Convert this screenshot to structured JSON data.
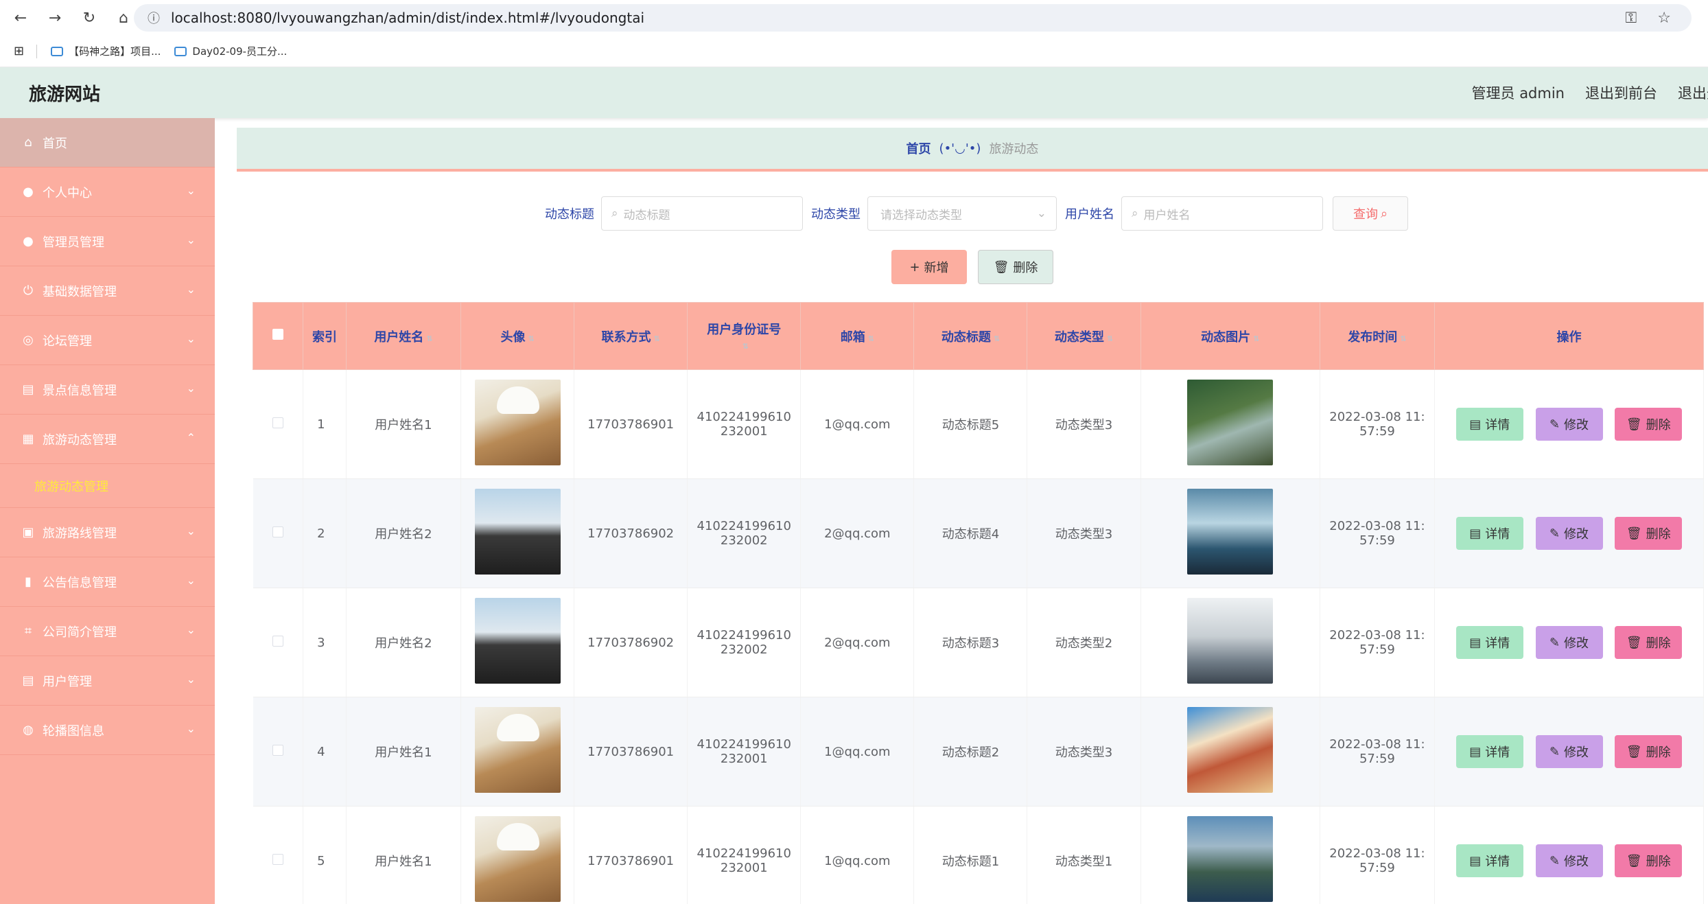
{
  "browser": {
    "url": "localhost:8080/lvyouwangzhan/admin/dist/index.html#/lvyoudongtai",
    "bookmarks": [
      "【码神之路】项目...",
      "Day02-09-员工分..."
    ]
  },
  "header": {
    "site_title": "旅游网站",
    "admin_label": "管理员 admin",
    "front_label": "退出到前台",
    "logout_label": "退出登录"
  },
  "sidebar": {
    "home": "首页",
    "items": [
      {
        "label": "个人中心",
        "icon": "user-icon"
      },
      {
        "label": "管理员管理",
        "icon": "pin-icon"
      },
      {
        "label": "基础数据管理",
        "icon": "power-icon"
      },
      {
        "label": "论坛管理",
        "icon": "compass-icon"
      },
      {
        "label": "景点信息管理",
        "icon": "clipboard-icon"
      },
      {
        "label": "旅游动态管理",
        "icon": "grid-icon",
        "expanded": true
      },
      {
        "label": "旅游路线管理",
        "icon": "briefcase-icon"
      },
      {
        "label": "公告信息管理",
        "icon": "bar-chart-icon"
      },
      {
        "label": "公司简介管理",
        "icon": "crop-icon"
      },
      {
        "label": "用户管理",
        "icon": "clipboard-icon"
      },
      {
        "label": "轮播图信息",
        "icon": "globe-icon"
      }
    ],
    "submenu": "旅游动态管理"
  },
  "breadcrumb": {
    "home": "首页",
    "separator": "(•'◡'•)",
    "current": "旅游动态"
  },
  "search": {
    "title_label": "动态标题",
    "title_placeholder": "动态标题",
    "type_label": "动态类型",
    "type_placeholder": "请选择动态类型",
    "user_label": "用户姓名",
    "user_placeholder": "用户姓名",
    "query_button": "查询"
  },
  "actions": {
    "add": "新增",
    "delete": "删除"
  },
  "table": {
    "columns": [
      "索引",
      "用户姓名",
      "头像",
      "联系方式",
      "用户身份证号",
      "邮箱",
      "动态标题",
      "动态类型",
      "动态图片",
      "发布时间",
      "操作"
    ],
    "rows": [
      {
        "index": "1",
        "name": "用户姓名1",
        "avatar": "cat",
        "phone": "17703786901",
        "id1": "410224199610",
        "id2": "232001",
        "email": "1@qq.com",
        "title": "动态标题5",
        "type": "动态类型3",
        "pic": "canyon",
        "date": "2022-03-08 11:",
        "time": "57:59"
      },
      {
        "index": "2",
        "name": "用户姓名2",
        "avatar": "man",
        "phone": "17703786902",
        "id1": "410224199610",
        "id2": "232002",
        "email": "2@qq.com",
        "title": "动态标题4",
        "type": "动态类型3",
        "pic": "waves",
        "date": "2022-03-08 11:",
        "time": "57:59"
      },
      {
        "index": "3",
        "name": "用户姓名2",
        "avatar": "man",
        "phone": "17703786902",
        "id1": "410224199610",
        "id2": "232002",
        "email": "2@qq.com",
        "title": "动态标题3",
        "type": "动态类型2",
        "pic": "snow",
        "date": "2022-03-08 11:",
        "time": "57:59"
      },
      {
        "index": "4",
        "name": "用户姓名1",
        "avatar": "cat",
        "phone": "17703786901",
        "id1": "410224199610",
        "id2": "232001",
        "email": "1@qq.com",
        "title": "动态标题2",
        "type": "动态类型3",
        "pic": "castle",
        "date": "2022-03-08 11:",
        "time": "57:59"
      },
      {
        "index": "5",
        "name": "用户姓名1",
        "avatar": "cat",
        "phone": "17703786901",
        "id1": "410224199610",
        "id2": "232001",
        "email": "1@qq.com",
        "title": "动态标题1",
        "type": "动态类型1",
        "pic": "lake",
        "date": "2022-03-08 11:",
        "time": "57:59"
      }
    ],
    "op_detail": "详情",
    "op_edit": "修改",
    "op_delete": "删除"
  }
}
